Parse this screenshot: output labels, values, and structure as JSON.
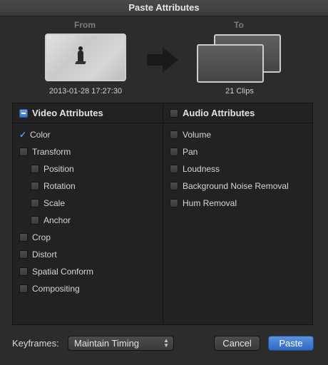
{
  "window": {
    "title": "Paste Attributes"
  },
  "from": {
    "heading": "From",
    "timestamp": "2013-01-28 17:27:30"
  },
  "to": {
    "heading": "To",
    "clip_count": "21 Clips"
  },
  "video": {
    "header": "Video Attributes",
    "items": [
      {
        "label": "Color",
        "checked": true
      },
      {
        "label": "Transform",
        "checked": false
      },
      {
        "label": "Position",
        "checked": false
      },
      {
        "label": "Rotation",
        "checked": false
      },
      {
        "label": "Scale",
        "checked": false
      },
      {
        "label": "Anchor",
        "checked": false
      },
      {
        "label": "Crop",
        "checked": false
      },
      {
        "label": "Distort",
        "checked": false
      },
      {
        "label": "Spatial Conform",
        "checked": false
      },
      {
        "label": "Compositing",
        "checked": false
      }
    ]
  },
  "audio": {
    "header": "Audio Attributes",
    "items": [
      {
        "label": "Volume",
        "checked": false
      },
      {
        "label": "Pan",
        "checked": false
      },
      {
        "label": "Loudness",
        "checked": false
      },
      {
        "label": "Background Noise Removal",
        "checked": false
      },
      {
        "label": "Hum Removal",
        "checked": false
      }
    ]
  },
  "footer": {
    "keyframes_label": "Keyframes:",
    "keyframes_value": "Maintain Timing",
    "cancel_label": "Cancel",
    "paste_label": "Paste"
  },
  "colors": {
    "accent": "#3f78c6",
    "background": "#2c2c2c",
    "panel": "#222222"
  }
}
